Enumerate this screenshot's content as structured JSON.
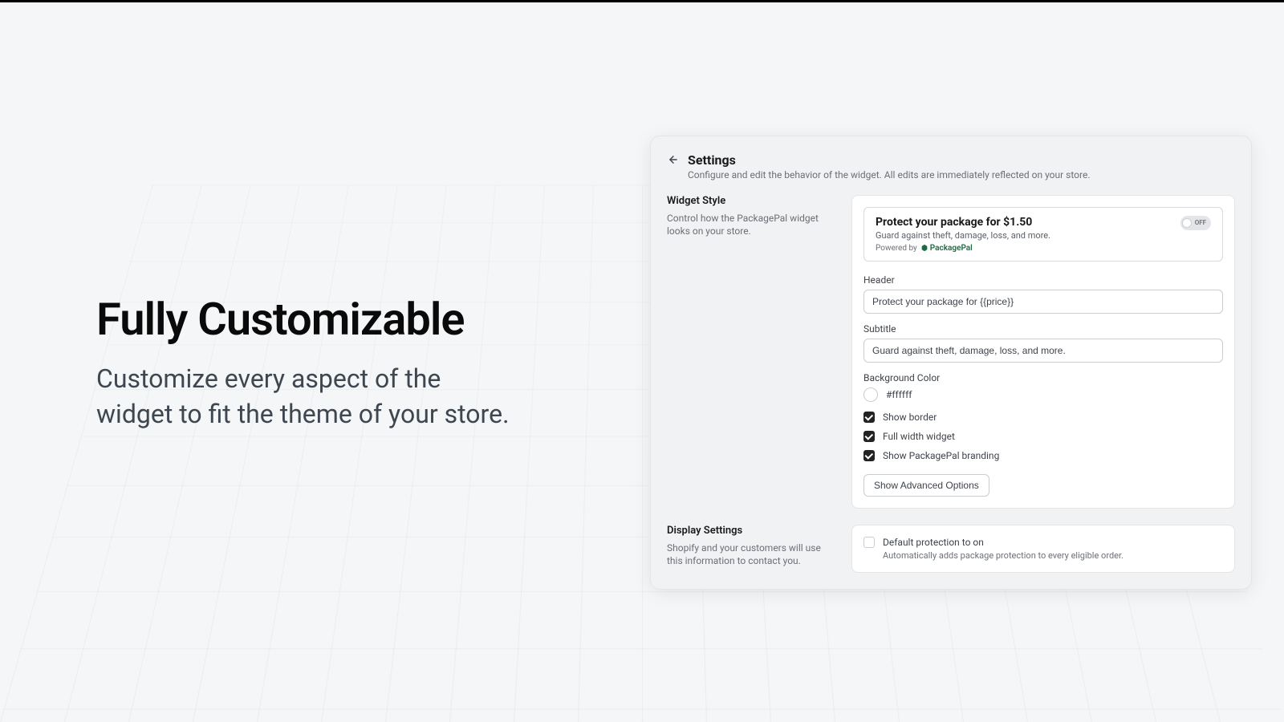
{
  "hero": {
    "title": "Fully Customizable",
    "subtitle": "Customize every aspect of the widget to fit the theme of your store."
  },
  "settings": {
    "title": "Settings",
    "subtitle": "Configure and edit the behavior of the widget. All edits are immediately reflected on your store."
  },
  "widget_style": {
    "title": "Widget Style",
    "desc": "Control how the PackagePal widget looks on your store.",
    "preview": {
      "title": "Protect your package for $1.50",
      "subtitle": "Guard against theft, damage, loss, and more.",
      "powered_prefix": "Powered by",
      "brand": "PackagePal",
      "toggle_label": "OFF"
    },
    "fields": {
      "header_label": "Header",
      "header_value": "Protect your package for {{price}}",
      "subtitle_label": "Subtitle",
      "subtitle_value": "Guard against theft, damage, loss, and more.",
      "bg_label": "Background Color",
      "bg_value": "#ffffff",
      "show_border": "Show border",
      "full_width": "Full width widget",
      "show_branding": "Show PackagePal branding",
      "advanced_button": "Show Advanced Options"
    }
  },
  "display_settings": {
    "title": "Display Settings",
    "desc": "Shopify and your customers will use this information to contact you.",
    "default_on_label": "Default protection to on",
    "default_on_desc": "Automatically adds package protection to every eligible order."
  }
}
